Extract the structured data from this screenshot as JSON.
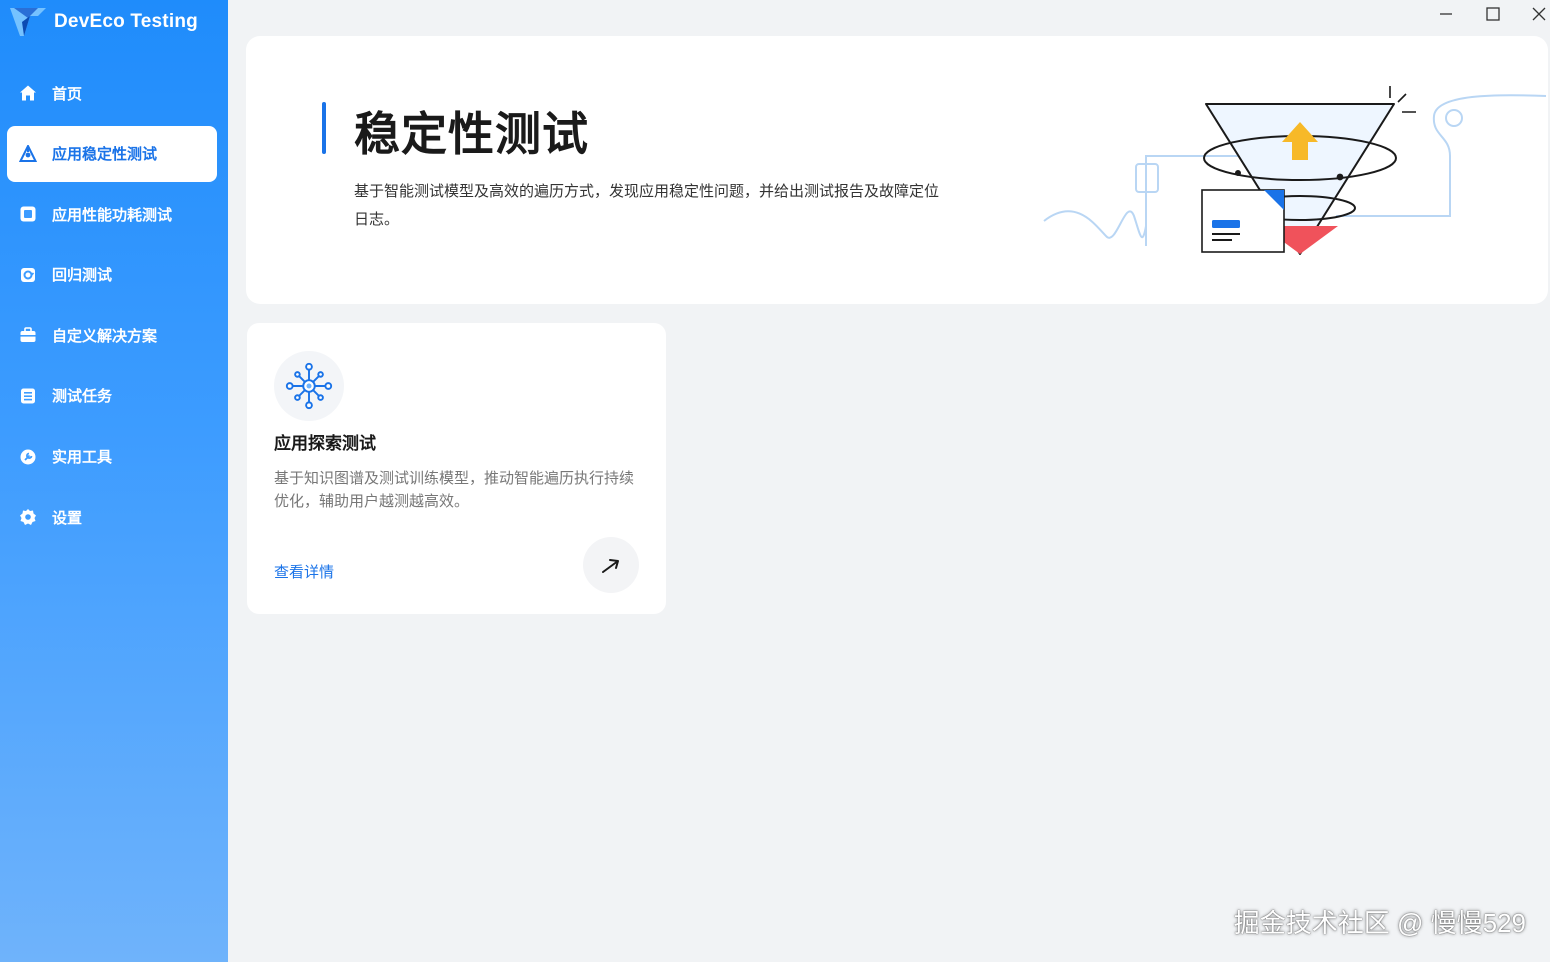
{
  "app": {
    "name": "DevEco Testing"
  },
  "sidebar": {
    "items": [
      {
        "label": "首页",
        "icon": "home-icon",
        "active": false
      },
      {
        "label": "应用稳定性测试",
        "icon": "stability-icon",
        "active": true
      },
      {
        "label": "应用性能功耗测试",
        "icon": "performance-icon",
        "active": false
      },
      {
        "label": "回归测试",
        "icon": "regression-icon",
        "active": false
      },
      {
        "label": "自定义解决方案",
        "icon": "toolbox-icon",
        "active": false
      },
      {
        "label": "测试任务",
        "icon": "task-list-icon",
        "active": false
      },
      {
        "label": "实用工具",
        "icon": "wrench-icon",
        "active": false
      },
      {
        "label": "设置",
        "icon": "gear-icon",
        "active": false
      }
    ]
  },
  "window_controls": [
    "minimize-icon",
    "maximize-icon",
    "close-icon"
  ],
  "banner": {
    "title": "稳定性测试",
    "description": "基于智能测试模型及高效的遍历方式，发现应用稳定性问题，并给出测试报告及故障定位日志。"
  },
  "cards": [
    {
      "icon": "network-node-icon",
      "title": "应用探索测试",
      "description": "基于知识图谱及测试训练模型，推动智能遍历执行持续优化，辅助用户越测越高效。",
      "link_label": "查看详情",
      "action_icon": "arrow-up-right-icon"
    }
  ],
  "watermark": "掘金技术社区 @ 慢慢529",
  "colors": {
    "accent": "#1a73e8",
    "sidebar_top": "#1f8cfb",
    "sidebar_bottom": "#6fb3fb",
    "background": "#f1f3f5"
  }
}
